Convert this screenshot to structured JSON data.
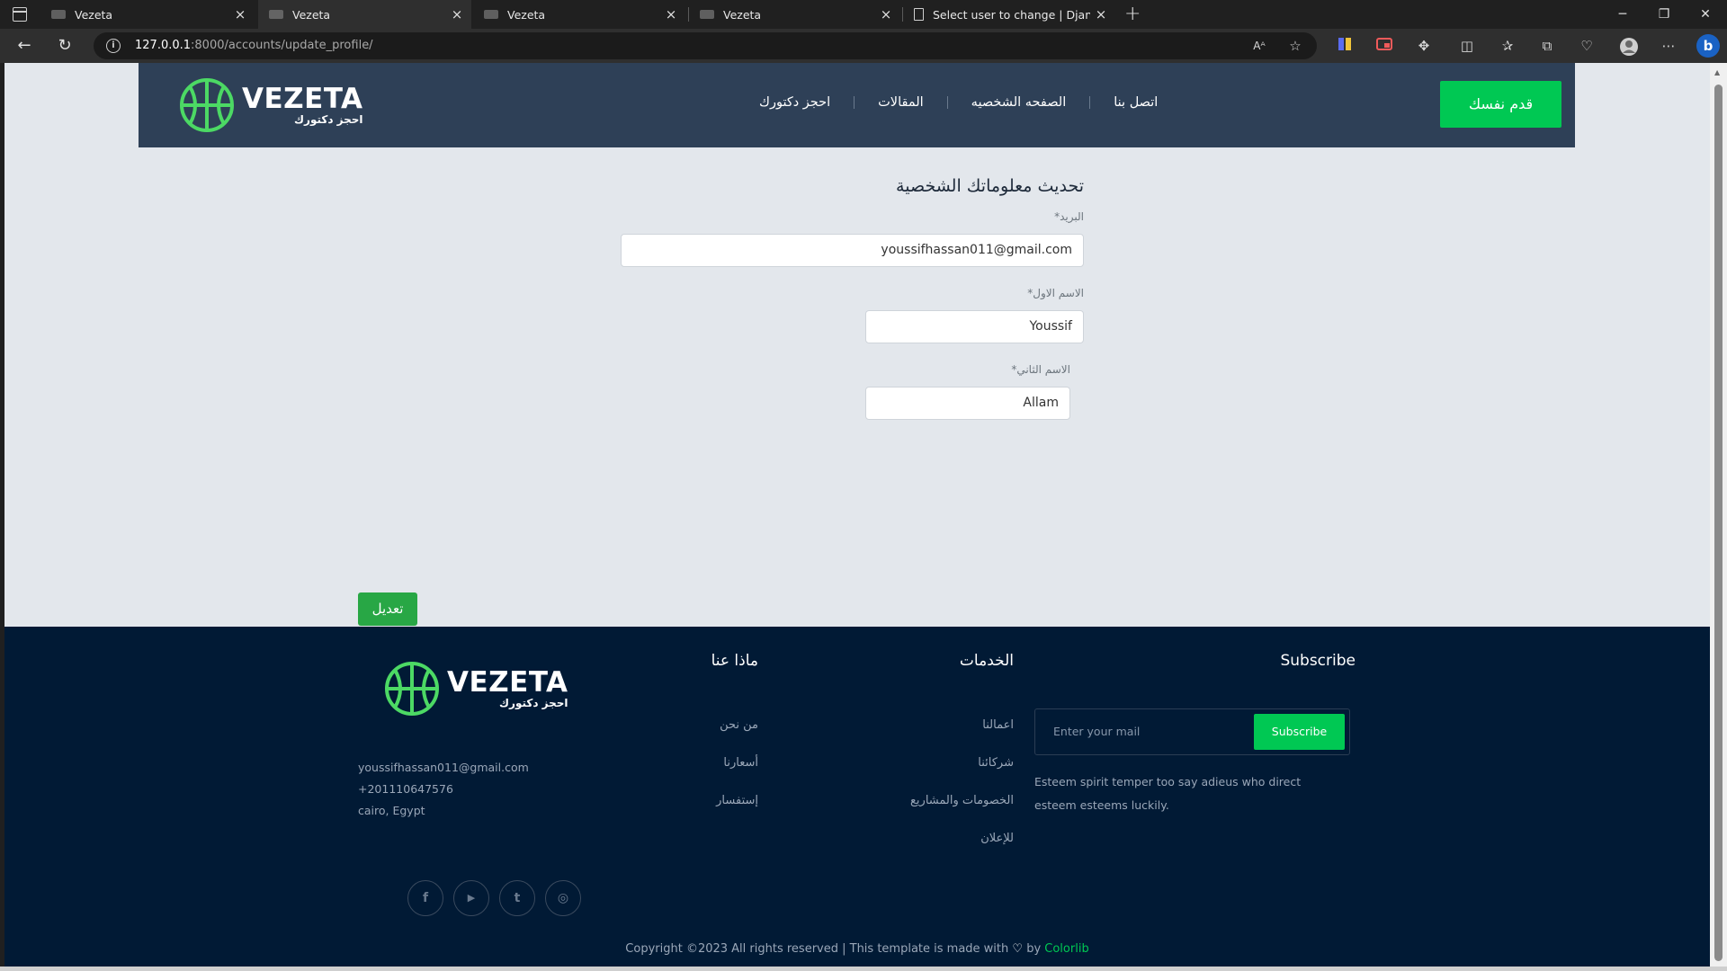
{
  "browser": {
    "tabs": [
      {
        "title": "Vezeta"
      },
      {
        "title": "Vezeta"
      },
      {
        "title": "Vezeta"
      },
      {
        "title": "Vezeta"
      },
      {
        "title": "Select user to change | Django si"
      }
    ],
    "tab_close": "×",
    "new_tab": "+",
    "url_host": "127.0.0.1",
    "url_rest": ":8000/accounts/update_profile/",
    "icons": [
      "back-icon",
      "refresh-icon",
      "info-icon",
      "read-aloud-icon",
      "favorite-icon",
      "collections-icon",
      "screen-cast-icon",
      "extensions-icon",
      "split-screen-icon",
      "favorites-icon",
      "browser-essentials-icon",
      "health-icon",
      "profile-icon",
      "more-icon",
      "bing-icon"
    ],
    "window_controls": {
      "minimize": "─",
      "restore": "❐",
      "close": "✕"
    }
  },
  "header": {
    "logo_word": "VEZETA",
    "logo_sub": "احجز دكتورك",
    "nav": [
      "احجز دكتورك",
      "المقالات",
      "الصفحه الشخصيه",
      "اتصل بنا"
    ],
    "cta": "قدم نفسك",
    "accent": "#00c853",
    "bg": "#2e4057"
  },
  "form": {
    "title": "تحديث معلوماتك الشخصية",
    "email_label": "البريد*",
    "email_value": "youssifhassan011@gmail.com",
    "first_name_label": "الاسم الاول*",
    "first_name_value": "Youssif",
    "last_name_label": "الاسم الثاني*",
    "last_name_value": "Allam",
    "submit": "تعديل"
  },
  "footer": {
    "logo_word": "VEZETA",
    "logo_sub": "احجز دكتورك",
    "email": "youssifhassan011@gmail.com",
    "phone": "+201110647576",
    "address": "cairo, Egypt",
    "about_heading": "ماذا عنا",
    "about_links": [
      "من نحن",
      "أسعارنا",
      "إستفسار"
    ],
    "services_heading": "الخدمات",
    "services_links": [
      "اعمالنا",
      "شركائنا",
      "الخصومات والمشاريع",
      "للإعلان"
    ],
    "subscribe_heading": "Subscribe",
    "subscribe_placeholder": "Enter your mail",
    "subscribe_button": "Subscribe",
    "subscribe_desc": "Esteem spirit temper too say adieus who direct esteem esteems luckily.",
    "social": [
      {
        "name": "facebook-icon",
        "glyph": "f"
      },
      {
        "name": "youtube-icon",
        "glyph": "▶"
      },
      {
        "name": "twitter-icon",
        "glyph": "t"
      },
      {
        "name": "instagram-icon",
        "glyph": "◎"
      }
    ],
    "copyright_pre": "Copyright ©2023 All rights reserved | This template is made with",
    "copyright_heart": "♡",
    "copyright_by": "by",
    "copyright_brand": "Colorlib",
    "bg": "#011a35"
  }
}
